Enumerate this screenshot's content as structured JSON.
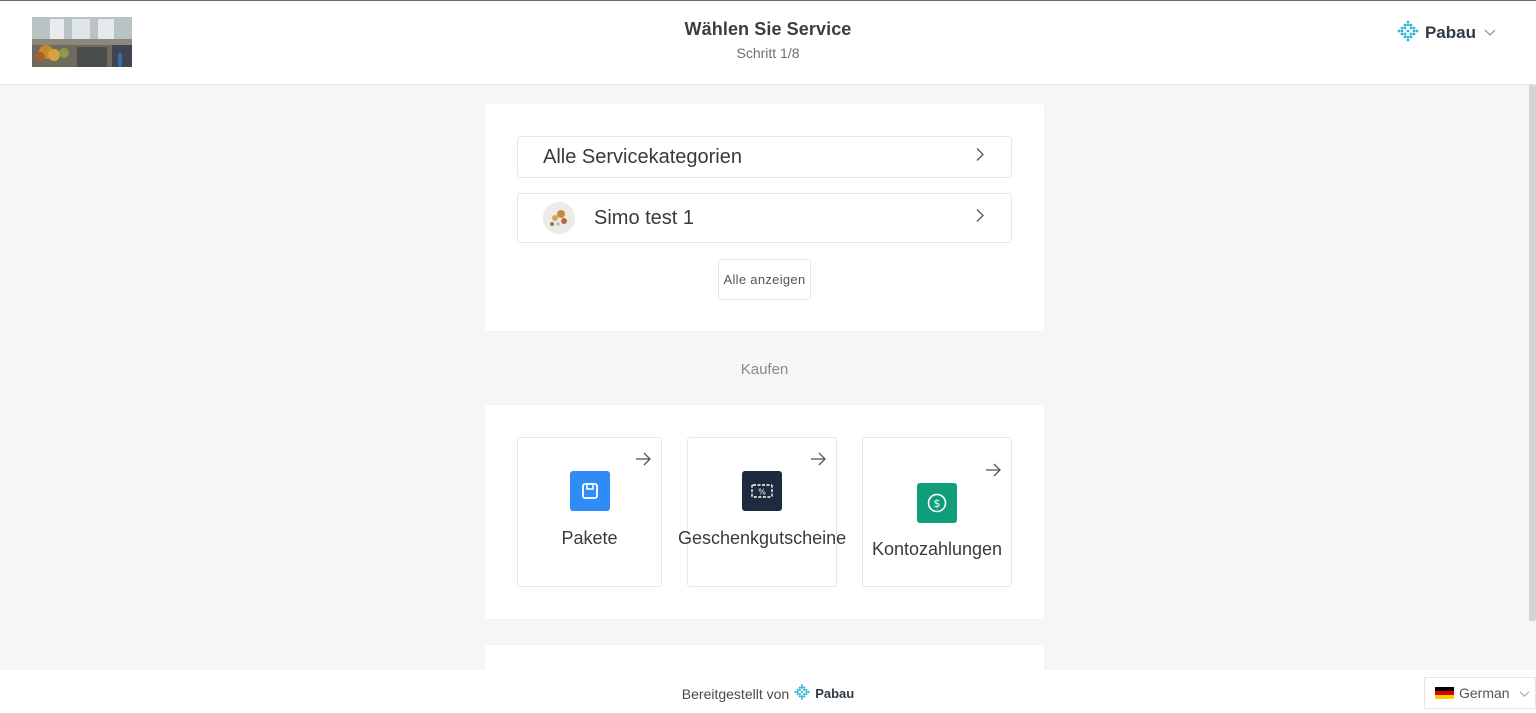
{
  "header": {
    "title": "Wählen Sie Service",
    "step": "Schritt 1/8",
    "brand": "Pabau"
  },
  "categories": {
    "all_label": "Alle Servicekategorien",
    "items": [
      {
        "label": "Simo test 1"
      }
    ],
    "show_all": "Alle anzeigen"
  },
  "buy": {
    "section_label": "Kaufen",
    "tiles": [
      {
        "label": "Pakete",
        "icon": "package-icon",
        "color": "#2f8cf7"
      },
      {
        "label": "Geschenkgutscheine",
        "icon": "voucher-icon",
        "color": "#1e2a3d"
      },
      {
        "label": "Kontozahlungen",
        "icon": "dollar-icon",
        "color": "#0f9d7a"
      }
    ]
  },
  "footer": {
    "powered_by": "Bereitgestellt von",
    "brand": "Pabau",
    "language": "German"
  },
  "colors": {
    "accent": "#2fb6d5",
    "background": "#f6f6f5"
  }
}
